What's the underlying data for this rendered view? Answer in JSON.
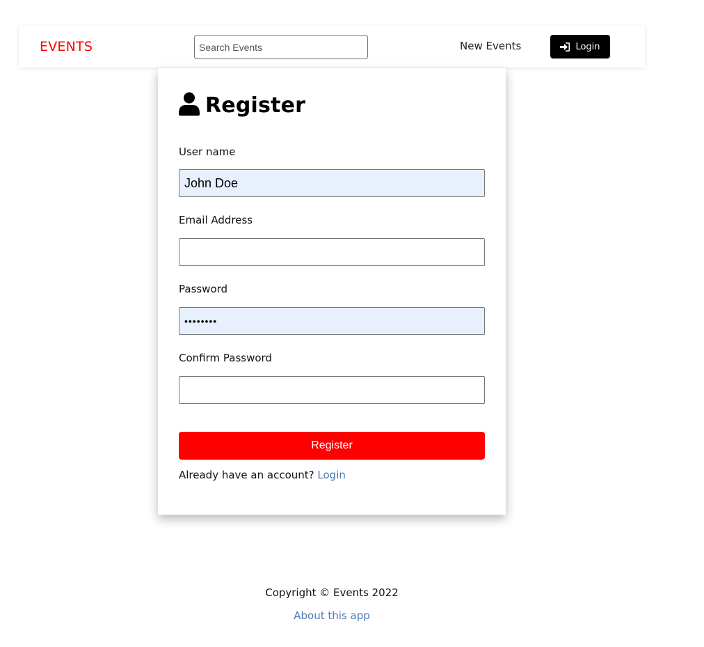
{
  "navbar": {
    "brand": "EVENTS",
    "search_placeholder": "Search Events",
    "new_events": "New Events",
    "login_label": "Login",
    "login_icon": "sign-in-icon"
  },
  "register": {
    "title": "Register",
    "title_icon": "user-icon",
    "fields": {
      "username": {
        "label": "User name",
        "value": "John Doe"
      },
      "email": {
        "label": "Email Address",
        "value": ""
      },
      "password": {
        "label": "Password",
        "value": "••••••••"
      },
      "confirm_password": {
        "label": "Confirm Password",
        "value": ""
      }
    },
    "submit_label": "Register",
    "already_text": "Already have an account?",
    "login_link": "Login"
  },
  "footer": {
    "copyright": "Copyright © Events 2022",
    "about": "About this app"
  },
  "colors": {
    "brand": "#ff0000",
    "primary_button": "#ff0000",
    "login_button": "#000000",
    "link": "#4a78b5",
    "autofill_bg": "#e8f0fe"
  }
}
